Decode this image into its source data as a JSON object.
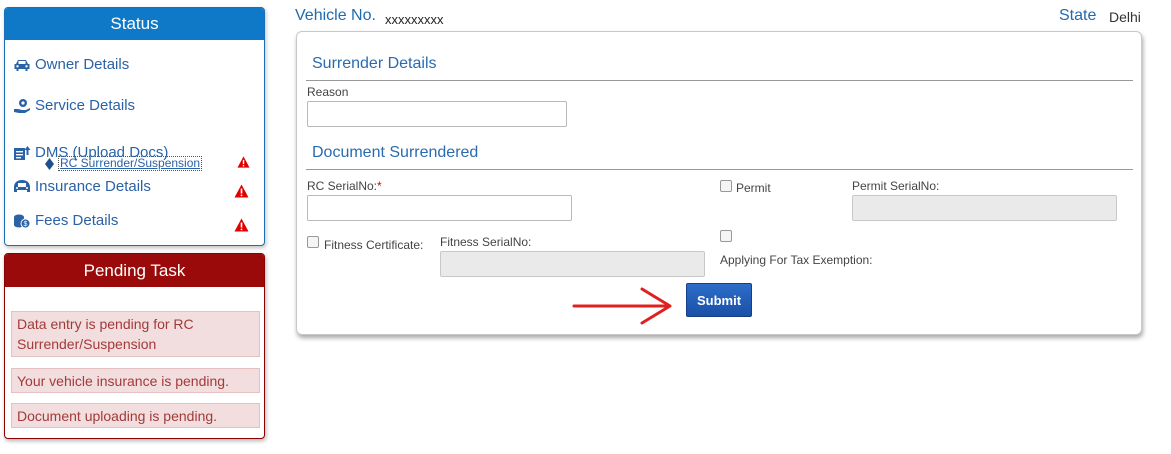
{
  "status": {
    "title": "Status",
    "items": [
      {
        "label": "Owner Details",
        "icon": "car-icon",
        "warning": false
      },
      {
        "label": "Service Details",
        "icon": "service-hand-icon",
        "warning": false
      },
      {
        "label": "DMS (Upload Docs)",
        "icon": "upload-docs-icon",
        "warning": true
      },
      {
        "label": "Insurance Details",
        "icon": "insurance-car-icon",
        "warning": true
      },
      {
        "label": "Fees Details",
        "icon": "coins-icon",
        "warning": true
      }
    ],
    "sub_item": {
      "label": "RC Surrender/Suspension",
      "icon": "diamond-bullet-icon",
      "warning": true
    }
  },
  "pending": {
    "title": "Pending Task",
    "items": [
      "Data entry is pending for RC Surrender/Suspension",
      "Your vehicle insurance is pending.",
      "Document uploading is pending."
    ]
  },
  "header": {
    "vehicle_label": "Vehicle No.",
    "vehicle_value": "xxxxxxxxx",
    "state_label": "State",
    "state_value": "Delhi"
  },
  "form": {
    "surrender_title": "Surrender Details",
    "reason_label": "Reason",
    "reason_value": "",
    "document_title": "Document Surrendered",
    "rc_serial_label": "RC SerialNo:",
    "rc_serial_required": "*",
    "rc_serial_value": "",
    "permit_label": "Permit",
    "permit_serial_label": "Permit SerialNo:",
    "permit_serial_value": "",
    "fitness_label": "Fitness Certificate:",
    "fitness_serial_label": "Fitness SerialNo:",
    "fitness_serial_value": "",
    "tax_exemption_label": "Applying For Tax Exemption:",
    "submit_label": "Submit"
  },
  "colors": {
    "status_header": "#0f79c7",
    "pending_header": "#9a0a0a",
    "accent_blue": "#2a6bb0",
    "warning_red": "#e00000",
    "arrow_red": "#e02020"
  }
}
